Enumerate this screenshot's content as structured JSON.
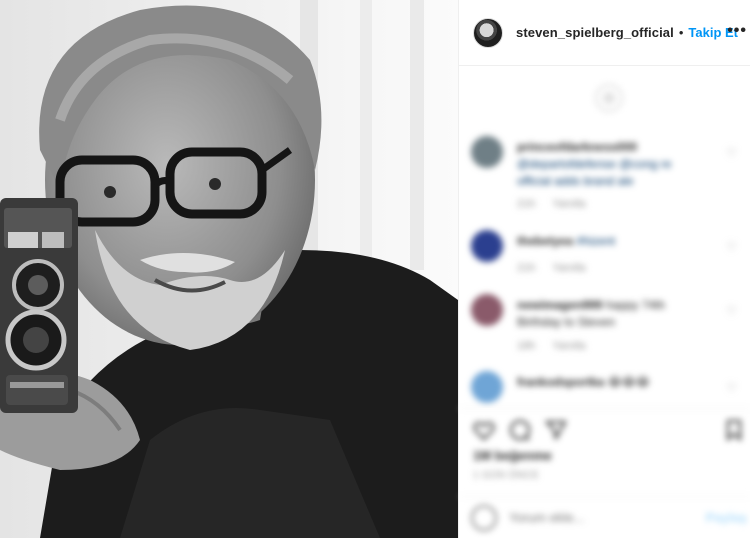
{
  "header": {
    "username": "steven_spielberg_official",
    "separator": "•",
    "follow_label": "Takip Et",
    "more_icon": "more-horizontal-icon"
  },
  "comments": [
    {
      "username": "princeofdarkness000",
      "text": "@departofdefense @cong re official adds brand ale",
      "meta_time": "21h",
      "meta_reply": "Yanıtla",
      "avatar_color": "#6f7f86"
    },
    {
      "username": "thebetyea",
      "text": "#hizent",
      "meta_time": "21h",
      "meta_reply": "Yanıtla",
      "avatar_color": "#2b3f8f"
    },
    {
      "username": "newimagen999",
      "text": "happy 74th Birthday to Steven",
      "meta_time": "18h",
      "meta_reply": "Yanıtla",
      "avatar_color": "#8a5a6a"
    },
    {
      "username": "frankodsportka",
      "text": "😂😂😂",
      "meta_time": "",
      "meta_reply": "",
      "avatar_color": "#6fa5d6"
    }
  ],
  "likes_text": "1M beğenme",
  "date_text": "1 GÜN ÖNCE",
  "add_comment": {
    "placeholder": "Yorum ekle...",
    "post_label": "Paylaş"
  },
  "colors": {
    "accent": "#0095f6",
    "text": "#262626",
    "muted": "#8e8e8e"
  }
}
